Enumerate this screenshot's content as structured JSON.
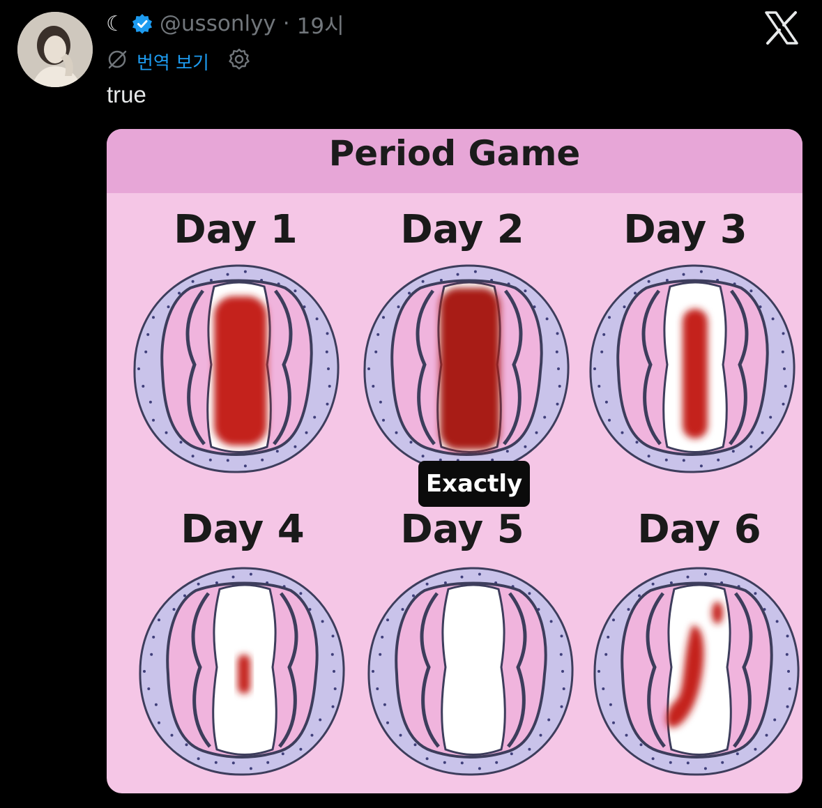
{
  "post": {
    "status_symbol": "☾",
    "handle": "@ussonlyy",
    "separator": "·",
    "time": "19시",
    "translate_label": "번역 보기",
    "text": "true"
  },
  "icons": {
    "moon": "moon-icon",
    "verified": "verified-badge-icon",
    "translate": "translate-icon",
    "settings": "gear-icon",
    "x_logo": "x-logo-icon"
  },
  "colors": {
    "background": "#000000",
    "link": "#1d9bf0",
    "secondary_text": "#71767b",
    "card_pink": "#f5c6e6",
    "blood": "#c4201e"
  },
  "image": {
    "title": "Period Game",
    "tooltip": "Exactly",
    "days": [
      {
        "label": "Day 1"
      },
      {
        "label": "Day 2"
      },
      {
        "label": "Day 3"
      },
      {
        "label": "Day 4"
      },
      {
        "label": "Day 5"
      },
      {
        "label": "Day 6"
      }
    ]
  }
}
